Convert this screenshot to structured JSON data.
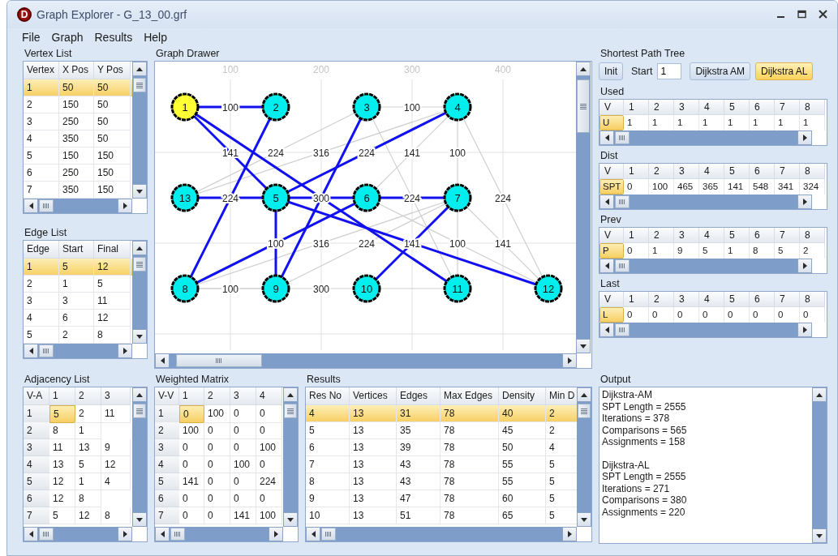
{
  "window": {
    "title": "Graph Explorer - G_13_00.grf",
    "app_icon_letter": "D"
  },
  "menu": [
    "File",
    "Graph",
    "Results",
    "Help"
  ],
  "vertex_list": {
    "title": "Vertex List",
    "columns": [
      "Vertex",
      "X Pos",
      "Y Pos"
    ],
    "rows": [
      {
        "cells": [
          "1",
          "50",
          "50"
        ],
        "selected": true
      },
      {
        "cells": [
          "2",
          "150",
          "50"
        ],
        "selected": false
      },
      {
        "cells": [
          "3",
          "250",
          "50"
        ],
        "selected": false
      },
      {
        "cells": [
          "4",
          "350",
          "50"
        ],
        "selected": false
      },
      {
        "cells": [
          "5",
          "150",
          "150"
        ],
        "selected": false
      },
      {
        "cells": [
          "6",
          "250",
          "150"
        ],
        "selected": false
      },
      {
        "cells": [
          "7",
          "350",
          "150"
        ],
        "selected": false
      }
    ]
  },
  "edge_list": {
    "title": "Edge List",
    "columns": [
      "Edge",
      "Start",
      "Final"
    ],
    "rows": [
      {
        "cells": [
          "1",
          "5",
          "12"
        ],
        "selected": true
      },
      {
        "cells": [
          "2",
          "1",
          "5"
        ],
        "selected": false
      },
      {
        "cells": [
          "3",
          "3",
          "11"
        ],
        "selected": false
      },
      {
        "cells": [
          "4",
          "6",
          "12"
        ],
        "selected": false
      },
      {
        "cells": [
          "5",
          "2",
          "8"
        ],
        "selected": false
      }
    ]
  },
  "graph_drawer": {
    "title": "Graph Drawer",
    "x_ticks": [
      "100",
      "200",
      "300",
      "400"
    ],
    "nodes": [
      {
        "label": "1",
        "selected": true
      },
      {
        "label": "2",
        "selected": false
      },
      {
        "label": "3",
        "selected": false
      },
      {
        "label": "4",
        "selected": false
      },
      {
        "label": "13",
        "selected": false
      },
      {
        "label": "5",
        "selected": false
      },
      {
        "label": "6",
        "selected": false
      },
      {
        "label": "7",
        "selected": false
      },
      {
        "label": "8",
        "selected": false
      },
      {
        "label": "9",
        "selected": false
      },
      {
        "label": "10",
        "selected": false
      },
      {
        "label": "11",
        "selected": false
      },
      {
        "label": "12",
        "selected": false
      }
    ],
    "edges": [
      {
        "kind": "other",
        "weight": "100"
      },
      {
        "kind": "other",
        "weight": "224"
      },
      {
        "kind": "other",
        "weight": "316"
      },
      {
        "kind": "other",
        "weight": "141"
      },
      {
        "kind": "other",
        "weight": "100"
      },
      {
        "kind": "other",
        "weight": "300"
      },
      {
        "kind": "other",
        "weight": "224"
      },
      {
        "kind": "other",
        "weight": "224"
      },
      {
        "kind": "other",
        "weight": "316"
      },
      {
        "kind": "other",
        "weight": "224"
      },
      {
        "kind": "other",
        "weight": "100"
      },
      {
        "kind": "other",
        "weight": "141"
      },
      {
        "kind": "other",
        "weight": "100"
      },
      {
        "kind": "other",
        "weight": "300"
      },
      {
        "kind": "other"
      },
      {
        "kind": "tree",
        "weight": "100"
      },
      {
        "kind": "tree",
        "weight": "141"
      },
      {
        "kind": "tree"
      },
      {
        "kind": "tree",
        "weight": "224"
      },
      {
        "kind": "tree"
      },
      {
        "kind": "tree",
        "weight": "224"
      },
      {
        "kind": "tree"
      },
      {
        "kind": "tree"
      },
      {
        "kind": "tree",
        "weight": "100"
      },
      {
        "kind": "tree"
      },
      {
        "kind": "tree"
      },
      {
        "kind": "tree",
        "weight": "141"
      }
    ]
  },
  "shortest_path_tree": {
    "title": "Shortest Path Tree",
    "buttons": [
      {
        "label": "Init",
        "selected": false
      },
      {
        "label": "Dijkstra AM",
        "selected": false
      },
      {
        "label": "Dijkstra AL",
        "selected": true
      }
    ],
    "start_label": "Start",
    "start_value": "1",
    "arrays": [
      {
        "title": "Used",
        "columns": [
          "V",
          "1",
          "2",
          "3",
          "4",
          "5",
          "6",
          "7",
          "8"
        ],
        "row_label": "U",
        "values": [
          "1",
          "1",
          "1",
          "1",
          "1",
          "1",
          "1",
          "1"
        ]
      },
      {
        "title": "Dist",
        "columns": [
          "V",
          "1",
          "2",
          "3",
          "4",
          "5",
          "6",
          "7",
          "8"
        ],
        "row_label": "SPT",
        "values": [
          "0",
          "100",
          "465",
          "365",
          "141",
          "548",
          "341",
          "324"
        ]
      },
      {
        "title": "Prev",
        "columns": [
          "V",
          "1",
          "2",
          "3",
          "4",
          "5",
          "6",
          "7",
          "8"
        ],
        "row_label": "P",
        "values": [
          "0",
          "1",
          "9",
          "5",
          "1",
          "8",
          "5",
          "2"
        ]
      },
      {
        "title": "Last",
        "columns": [
          "V",
          "1",
          "2",
          "3",
          "4",
          "5",
          "6",
          "7",
          "8"
        ],
        "row_label": "L",
        "values": [
          "0",
          "0",
          "0",
          "0",
          "0",
          "0",
          "0",
          "0"
        ]
      }
    ]
  },
  "adjacency_list": {
    "title": "Adjacency List",
    "columns": [
      "V-A",
      "1",
      "2",
      "3"
    ],
    "rows": [
      {
        "cells": [
          "1",
          {
            "text": "5",
            "selected": true
          },
          {
            "text": "2",
            "selected": false
          },
          {
            "text": "11",
            "selected": false
          }
        ]
      },
      {
        "cells": [
          "2",
          {
            "text": "8",
            "selected": false
          },
          {
            "text": "1",
            "selected": false
          }
        ]
      },
      {
        "cells": [
          "3",
          {
            "text": "11",
            "selected": false
          },
          {
            "text": "13",
            "selected": false
          },
          {
            "text": "9",
            "selected": false
          }
        ]
      },
      {
        "cells": [
          "4",
          {
            "text": "13",
            "selected": false
          },
          {
            "text": "5",
            "selected": false
          },
          {
            "text": "12",
            "selected": false
          }
        ]
      },
      {
        "cells": [
          "5",
          {
            "text": "12",
            "selected": false
          },
          {
            "text": "1",
            "selected": false
          },
          {
            "text": "4",
            "selected": false
          }
        ]
      },
      {
        "cells": [
          "6",
          {
            "text": "12",
            "selected": false
          },
          {
            "text": "8",
            "selected": false
          }
        ]
      },
      {
        "cells": [
          "7",
          {
            "text": "5",
            "selected": false
          },
          {
            "text": "12",
            "selected": false
          },
          {
            "text": "8",
            "selected": false
          }
        ]
      }
    ]
  },
  "weighted_matrix": {
    "title": "Weighted Matrix",
    "columns": [
      "V-V",
      "1",
      "2",
      "3",
      "4"
    ],
    "rows": [
      {
        "cells": [
          "1",
          {
            "text": "0",
            "selected": true
          },
          {
            "text": "100",
            "selected": false
          },
          {
            "text": "0",
            "selected": false
          },
          {
            "text": "0",
            "selected": false
          }
        ]
      },
      {
        "cells": [
          "2",
          {
            "text": "100",
            "selected": false
          },
          {
            "text": "0",
            "selected": false
          },
          {
            "text": "0",
            "selected": false
          },
          {
            "text": "0",
            "selected": false
          }
        ]
      },
      {
        "cells": [
          "3",
          {
            "text": "0",
            "selected": false
          },
          {
            "text": "0",
            "selected": false
          },
          {
            "text": "0",
            "selected": false
          },
          {
            "text": "100",
            "selected": false
          }
        ]
      },
      {
        "cells": [
          "4",
          {
            "text": "0",
            "selected": false
          },
          {
            "text": "0",
            "selected": false
          },
          {
            "text": "100",
            "selected": false
          },
          {
            "text": "0",
            "selected": false
          }
        ]
      },
      {
        "cells": [
          "5",
          {
            "text": "141",
            "selected": false
          },
          {
            "text": "0",
            "selected": false
          },
          {
            "text": "0",
            "selected": false
          },
          {
            "text": "224",
            "selected": false
          }
        ]
      },
      {
        "cells": [
          "6",
          {
            "text": "0",
            "selected": false
          },
          {
            "text": "0",
            "selected": false
          },
          {
            "text": "0",
            "selected": false
          },
          {
            "text": "0",
            "selected": false
          }
        ]
      },
      {
        "cells": [
          "7",
          {
            "text": "0",
            "selected": false
          },
          {
            "text": "0",
            "selected": false
          },
          {
            "text": "141",
            "selected": false
          },
          {
            "text": "100",
            "selected": false
          }
        ]
      }
    ]
  },
  "results": {
    "title": "Results",
    "columns": [
      "Res No",
      "Vertices",
      "Edges",
      "Max Edges",
      "Density",
      "Min D"
    ],
    "rows": [
      {
        "cells": [
          "4",
          "13",
          "31",
          "78",
          "40",
          "2"
        ],
        "selected": true
      },
      {
        "cells": [
          "5",
          "13",
          "35",
          "78",
          "45",
          "2"
        ],
        "selected": false
      },
      {
        "cells": [
          "6",
          "13",
          "39",
          "78",
          "50",
          "4"
        ],
        "selected": false
      },
      {
        "cells": [
          "7",
          "13",
          "43",
          "78",
          "55",
          "5"
        ],
        "selected": false
      },
      {
        "cells": [
          "8",
          "13",
          "43",
          "78",
          "55",
          "5"
        ],
        "selected": false
      },
      {
        "cells": [
          "9",
          "13",
          "47",
          "78",
          "60",
          "5"
        ],
        "selected": false
      },
      {
        "cells": [
          "10",
          "13",
          "51",
          "78",
          "65",
          "5"
        ],
        "selected": false
      }
    ]
  },
  "output": {
    "title": "Output",
    "blocks": [
      [
        "Dijkstra-AM",
        "SPT Length = 2555",
        "Iterations = 378",
        "Comparisons = 565",
        "Assignments = 158"
      ],
      [
        "Dijkstra-AL",
        "SPT Length = 2555",
        "Iterations = 271",
        "Comparisons = 380",
        "Assignments = 220"
      ]
    ]
  }
}
